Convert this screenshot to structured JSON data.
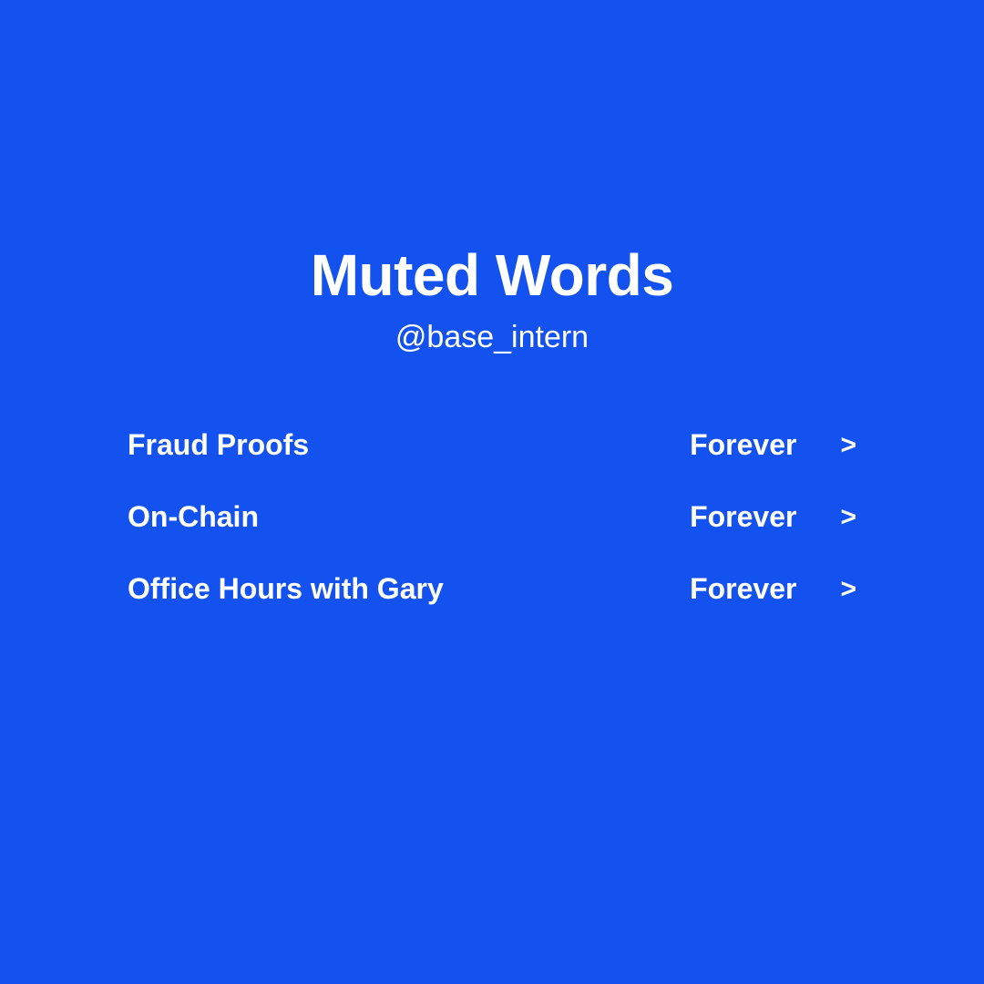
{
  "header": {
    "title": "Muted Words",
    "handle": "@base_intern"
  },
  "muted_words": [
    {
      "word": "Fraud Proofs",
      "duration": "Forever"
    },
    {
      "word": "On-Chain",
      "duration": "Forever"
    },
    {
      "word": "Office Hours with Gary",
      "duration": "Forever"
    }
  ],
  "chevron_glyph": ">"
}
